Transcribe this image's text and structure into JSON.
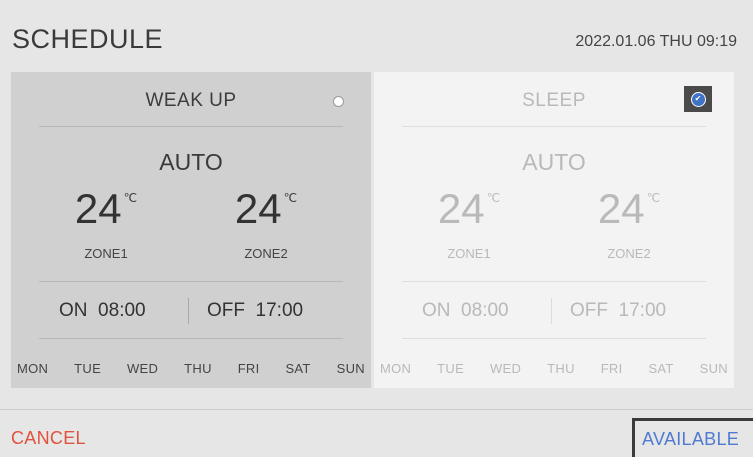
{
  "header": {
    "title": "SCHEDULE",
    "datetime": "2022.01.06 THU 09:19"
  },
  "colors": {
    "background": "#e6e6e6",
    "selected_panel": "#d0d0d0",
    "unselected_panel": "#f3f3f3",
    "cancel": "#e0523e",
    "available": "#4f7ad0",
    "check": "#3f73c6"
  },
  "schedules": [
    {
      "name": "WEAK UP",
      "selected": false,
      "selector_icon": "radio-empty-icon",
      "mode": "AUTO",
      "zone1_temp": "24",
      "zone1_label": "ZONE1",
      "zone2_temp": "24",
      "zone2_label": "ZONE2",
      "unit": "℃",
      "on_time": "ON  08:00",
      "off_time": "OFF  17:00",
      "days": [
        "MON",
        "TUE",
        "WED",
        "THU",
        "FRI",
        "SAT",
        "SUN"
      ]
    },
    {
      "name": "SLEEP",
      "selected": true,
      "selector_icon": "check-circle-icon",
      "mode": "AUTO",
      "zone1_temp": "24",
      "zone1_label": "ZONE1",
      "zone2_temp": "24",
      "zone2_label": "ZONE2",
      "unit": "℃",
      "on_time": "ON  08:00",
      "off_time": "OFF  17:00",
      "days": [
        "MON",
        "TUE",
        "WED",
        "THU",
        "FRI",
        "SAT",
        "SUN"
      ]
    }
  ],
  "footer": {
    "cancel_label": "CANCEL",
    "available_label": "AVAILABLE"
  }
}
